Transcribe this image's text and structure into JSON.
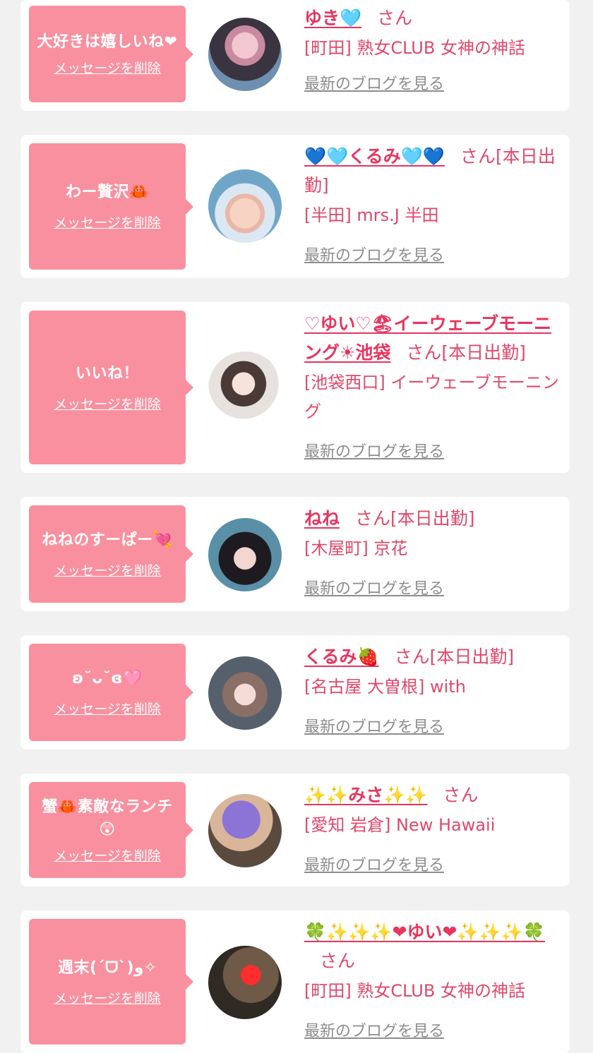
{
  "delete_label": "メッセージを削除",
  "blog_label": "最新のブログを見る",
  "colors": {
    "bubble": "#f9909f",
    "name": "#e8345e",
    "text": "#e0486a",
    "link": "#8d8d8d",
    "background": "#f1f1f1"
  },
  "items": [
    {
      "message": "大好きは嬉しいね❤",
      "name": "ゆき🩵",
      "suffix": "さん",
      "shop": "[町田] 熟女CLUB 女神の神話"
    },
    {
      "message": "わー贅沢🦀",
      "name": "💙🩵くるみ🩵💙",
      "suffix": "さん[本日出勤]",
      "shop": "[半田] mrs.J 半田"
    },
    {
      "message": "いいね！",
      "name": "♡ゆい♡🏖イーウェーブモーニング☀池袋",
      "suffix": "さん[本日出勤]",
      "shop": "[池袋西口] イーウェーブモーニング"
    },
    {
      "message": "ねねのすーぱー💘",
      "name": "ねね",
      "suffix": "さん[本日出勤]",
      "shop": "[木屋町] 京花"
    },
    {
      "message": "ʚ˘ᴗ˘ɞ🩷",
      "name": "くるみ🍓",
      "suffix": "さん[本日出勤]",
      "shop": "[名古屋 大曽根] with"
    },
    {
      "message": "蟹🦀素敵なランチ😲",
      "name": "✨✨みさ✨✨",
      "suffix": "さん",
      "shop": "[愛知 岩倉] New Hawaii"
    },
    {
      "message": "週末(ˊᗜˋ)و✧",
      "name": "🍀✨✨✨❤ゆい❤✨✨✨🍀",
      "suffix": "さん",
      "shop": "[町田] 熟女CLUB 女神の神話"
    }
  ]
}
